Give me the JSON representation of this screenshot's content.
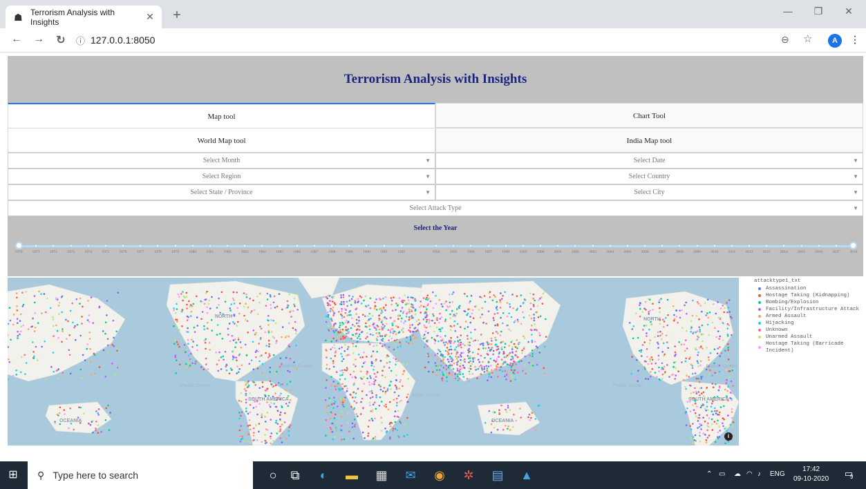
{
  "browser": {
    "tab_title": "Terrorism Analysis with Insights",
    "tab_close": "✕",
    "new_tab": "+",
    "url": "127.0.0.1:8050",
    "avatar_letter": "A",
    "window_min": "—",
    "window_restore": "❐",
    "window_close": "✕"
  },
  "app": {
    "title": "Terrorism Analysis with Insights",
    "tabs": [
      {
        "label": "Map tool"
      },
      {
        "label": "Chart Tool"
      }
    ],
    "subtabs": [
      {
        "label": "World Map tool"
      },
      {
        "label": "India Map tool"
      }
    ],
    "dropdowns": {
      "month": "Select Month",
      "date": "Select Date",
      "region": "Select Region",
      "country": "Select Country",
      "state": "Select State / Province",
      "city": "Select City",
      "attack_type": "Select Attack Type"
    },
    "year_slider": {
      "title": "Select the Year",
      "min": 1970,
      "max": 2018,
      "selected": [
        1970,
        2018
      ],
      "ticks": [
        "1970",
        "1971",
        "1972",
        "1973",
        "1974",
        "1975",
        "1976",
        "1977",
        "1978",
        "1979",
        "1980",
        "1981",
        "1982",
        "1983",
        "1984",
        "1985",
        "1986",
        "1987",
        "1988",
        "1989",
        "1990",
        "1991",
        "1992",
        "1994",
        "1995",
        "1996",
        "1997",
        "1998",
        "1999",
        "2000",
        "2001",
        "2002",
        "2003",
        "2004",
        "2005",
        "2006",
        "2007",
        "2008",
        "2009",
        "2010",
        "2011",
        "2012",
        "2013",
        "2014",
        "2015",
        "2016",
        "2017",
        "2018"
      ]
    },
    "map": {
      "labels": [
        "NORTH",
        "Pacific Ocean",
        "Atlantic Ocean",
        "SOUTH AMERICA",
        "Indian Ocean",
        "OCEANIA",
        "NORTH",
        "Pacific Ocean",
        "Atlantic Ocean",
        "SOUTH AMERICA",
        "OCEANIA"
      ],
      "info": "i"
    },
    "legend": {
      "title": "attacktype1_txt",
      "items": [
        {
          "label": "Assassination",
          "color": "#636efa"
        },
        {
          "label": "Hostage Taking (Kidnapping)",
          "color": "#ef553b"
        },
        {
          "label": "Bombing/Explosion",
          "color": "#00cc96"
        },
        {
          "label": "Facility/Infrastructure Attack",
          "color": "#ab63fa"
        },
        {
          "label": "Armed Assault",
          "color": "#ffa15a"
        },
        {
          "label": "Hijacking",
          "color": "#19d3f3"
        },
        {
          "label": "Unknown",
          "color": "#ff6692"
        },
        {
          "label": "Unarmed Assault",
          "color": "#b6e880"
        },
        {
          "label": "Hostage Taking (Barricade Incident)",
          "color": "#ff97ff"
        }
      ]
    }
  },
  "taskbar": {
    "search_placeholder": "Type here to search",
    "lang": "ENG",
    "time": "17:42",
    "date": "09-10-2020",
    "notifications": "9"
  }
}
